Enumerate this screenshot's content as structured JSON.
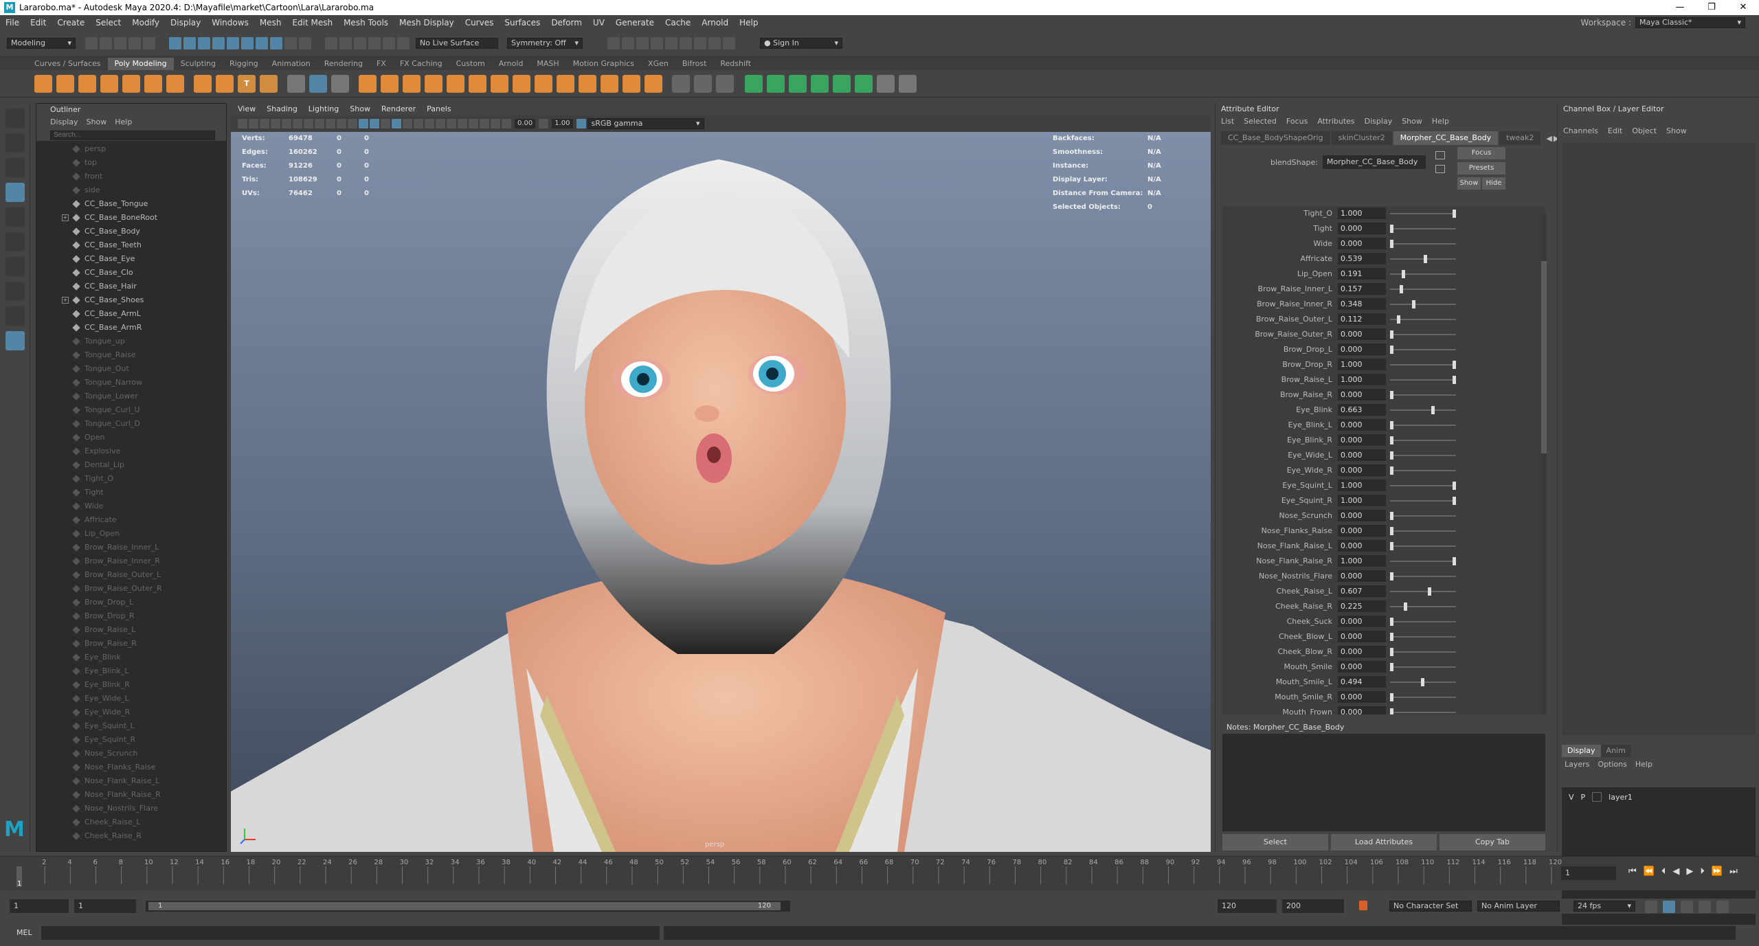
{
  "title": "Lararobo.ma* - Autodesk Maya 2020.4: D:\\Mayafile\\market\\Cartoon\\Lara\\Lararobo.ma",
  "menus": [
    "File",
    "Edit",
    "Create",
    "Select",
    "Modify",
    "Display",
    "Windows",
    "Mesh",
    "Edit Mesh",
    "Mesh Tools",
    "Mesh Display",
    "Curves",
    "Surfaces",
    "Deform",
    "UV",
    "Generate",
    "Cache",
    "Arnold",
    "Help"
  ],
  "workspace": {
    "label": "Workspace :",
    "value": "Maya Classic*"
  },
  "status": {
    "mode": "Modeling",
    "live": "No Live Surface",
    "symmetry": "Symmetry: Off",
    "signin": "Sign In"
  },
  "shelf_tabs": [
    "Curves / Surfaces",
    "Poly Modeling",
    "Sculpting",
    "Rigging",
    "Animation",
    "Rendering",
    "FX",
    "FX Caching",
    "Custom",
    "Arnold",
    "MASH",
    "Motion Graphics",
    "XGen",
    "Bifrost",
    "Redshift"
  ],
  "shelf_active": "Poly Modeling",
  "outliner": {
    "title": "Outliner",
    "menu": [
      "Display",
      "Show",
      "Help"
    ],
    "search": "Search...",
    "items": [
      {
        "name": "persp",
        "dim": true
      },
      {
        "name": "top",
        "dim": true
      },
      {
        "name": "front",
        "dim": true
      },
      {
        "name": "side",
        "dim": true
      },
      {
        "name": "CC_Base_Tongue",
        "dim": false
      },
      {
        "name": "CC_Base_BoneRoot",
        "dim": false,
        "exp": true
      },
      {
        "name": "CC_Base_Body",
        "dim": false
      },
      {
        "name": "CC_Base_Teeth",
        "dim": false
      },
      {
        "name": "CC_Base_Eye",
        "dim": false
      },
      {
        "name": "CC_Base_Clo",
        "dim": false
      },
      {
        "name": "CC_Base_Hair",
        "dim": false
      },
      {
        "name": "CC_Base_Shoes",
        "dim": false,
        "exp": true
      },
      {
        "name": "CC_Base_ArmL",
        "dim": false
      },
      {
        "name": "CC_Base_ArmR",
        "dim": false
      },
      {
        "name": "Tongue_up",
        "dim": true
      },
      {
        "name": "Tongue_Raise",
        "dim": true
      },
      {
        "name": "Tongue_Out",
        "dim": true
      },
      {
        "name": "Tongue_Narrow",
        "dim": true
      },
      {
        "name": "Tongue_Lower",
        "dim": true
      },
      {
        "name": "Tongue_Curl_U",
        "dim": true
      },
      {
        "name": "Tongue_Curl_D",
        "dim": true
      },
      {
        "name": "Open",
        "dim": true
      },
      {
        "name": "Explosive",
        "dim": true
      },
      {
        "name": "Dental_Lip",
        "dim": true
      },
      {
        "name": "Tight_O",
        "dim": true
      },
      {
        "name": "Tight",
        "dim": true
      },
      {
        "name": "Wide",
        "dim": true
      },
      {
        "name": "Affricate",
        "dim": true
      },
      {
        "name": "Lip_Open",
        "dim": true
      },
      {
        "name": "Brow_Raise_Inner_L",
        "dim": true
      },
      {
        "name": "Brow_Raise_Inner_R",
        "dim": true
      },
      {
        "name": "Brow_Raise_Outer_L",
        "dim": true
      },
      {
        "name": "Brow_Raise_Outer_R",
        "dim": true
      },
      {
        "name": "Brow_Drop_L",
        "dim": true
      },
      {
        "name": "Brow_Drop_R",
        "dim": true
      },
      {
        "name": "Brow_Raise_L",
        "dim": true
      },
      {
        "name": "Brow_Raise_R",
        "dim": true
      },
      {
        "name": "Eye_Blink",
        "dim": true
      },
      {
        "name": "Eye_Blink_L",
        "dim": true
      },
      {
        "name": "Eye_Blink_R",
        "dim": true
      },
      {
        "name": "Eye_Wide_L",
        "dim": true
      },
      {
        "name": "Eye_Wide_R",
        "dim": true
      },
      {
        "name": "Eye_Squint_L",
        "dim": true
      },
      {
        "name": "Eye_Squint_R",
        "dim": true
      },
      {
        "name": "Nose_Scrunch",
        "dim": true
      },
      {
        "name": "Nose_Flanks_Raise",
        "dim": true
      },
      {
        "name": "Nose_Flank_Raise_L",
        "dim": true
      },
      {
        "name": "Nose_Flank_Raise_R",
        "dim": true
      },
      {
        "name": "Nose_Nostrils_Flare",
        "dim": true
      },
      {
        "name": "Cheek_Raise_L",
        "dim": true
      },
      {
        "name": "Cheek_Raise_R",
        "dim": true
      }
    ]
  },
  "viewport": {
    "menu": [
      "View",
      "Shading",
      "Lighting",
      "Show",
      "Renderer",
      "Panels"
    ],
    "near": "0.00",
    "far": "1.00",
    "colorspace": "sRGB gamma",
    "camera": "persp",
    "hud_left": [
      [
        "Verts:",
        "69478",
        "0",
        "0"
      ],
      [
        "Edges:",
        "160262",
        "0",
        "0"
      ],
      [
        "Faces:",
        "91226",
        "0",
        "0"
      ],
      [
        "Tris:",
        "108629",
        "0",
        "0"
      ],
      [
        "UVs:",
        "76462",
        "0",
        "0"
      ]
    ],
    "hud_right": [
      [
        "Backfaces:",
        "N/A"
      ],
      [
        "Smoothness:",
        "N/A"
      ],
      [
        "Instance:",
        "N/A"
      ],
      [
        "Display Layer:",
        "N/A"
      ],
      [
        "Distance From Camera:",
        "N/A"
      ],
      [
        "Selected Objects:",
        "0"
      ]
    ]
  },
  "attr": {
    "title": "Attribute Editor",
    "menu": [
      "List",
      "Selected",
      "Focus",
      "Attributes",
      "Display",
      "Show",
      "Help"
    ],
    "tabs": [
      "CC_Base_BodyShapeOrig",
      "skinCluster2",
      "Morpher_CC_Base_Body",
      "tweak2"
    ],
    "active_tab": "Morpher_CC_Base_Body",
    "bs_label": "blendShape:",
    "bs_value": "Morpher_CC_Base_Body",
    "btn_focus": "Focus",
    "btn_presets": "Presets",
    "btn_show": "Show",
    "btn_hide": "Hide",
    "rows": [
      {
        "name": "Tight_O",
        "value": "1.000",
        "frac": 1.0
      },
      {
        "name": "Tight",
        "value": "0.000",
        "frac": 0
      },
      {
        "name": "Wide",
        "value": "0.000",
        "frac": 0
      },
      {
        "name": "Affricate",
        "value": "0.539",
        "frac": 0.539
      },
      {
        "name": "Lip_Open",
        "value": "0.191",
        "frac": 0.191
      },
      {
        "name": "Brow_Raise_Inner_L",
        "value": "0.157",
        "frac": 0.157
      },
      {
        "name": "Brow_Raise_Inner_R",
        "value": "0.348",
        "frac": 0.348
      },
      {
        "name": "Brow_Raise_Outer_L",
        "value": "0.112",
        "frac": 0.112
      },
      {
        "name": "Brow_Raise_Outer_R",
        "value": "0.000",
        "frac": 0
      },
      {
        "name": "Brow_Drop_L",
        "value": "0.000",
        "frac": 0
      },
      {
        "name": "Brow_Drop_R",
        "value": "1.000",
        "frac": 1
      },
      {
        "name": "Brow_Raise_L",
        "value": "1.000",
        "frac": 1
      },
      {
        "name": "Brow_Raise_R",
        "value": "0.000",
        "frac": 0
      },
      {
        "name": "Eye_Blink",
        "value": "0.663",
        "frac": 0.663
      },
      {
        "name": "Eye_Blink_L",
        "value": "0.000",
        "frac": 0
      },
      {
        "name": "Eye_Blink_R",
        "value": "0.000",
        "frac": 0
      },
      {
        "name": "Eye_Wide_L",
        "value": "0.000",
        "frac": 0
      },
      {
        "name": "Eye_Wide_R",
        "value": "0.000",
        "frac": 0
      },
      {
        "name": "Eye_Squint_L",
        "value": "1.000",
        "frac": 1
      },
      {
        "name": "Eye_Squint_R",
        "value": "1.000",
        "frac": 1
      },
      {
        "name": "Nose_Scrunch",
        "value": "0.000",
        "frac": 0
      },
      {
        "name": "Nose_Flanks_Raise",
        "value": "0.000",
        "frac": 0
      },
      {
        "name": "Nose_Flank_Raise_L",
        "value": "0.000",
        "frac": 0
      },
      {
        "name": "Nose_Flank_Raise_R",
        "value": "1.000",
        "frac": 1
      },
      {
        "name": "Nose_Nostrils_Flare",
        "value": "0.000",
        "frac": 0
      },
      {
        "name": "Cheek_Raise_L",
        "value": "0.607",
        "frac": 0.607
      },
      {
        "name": "Cheek_Raise_R",
        "value": "0.225",
        "frac": 0.225
      },
      {
        "name": "Cheek_Suck",
        "value": "0.000",
        "frac": 0
      },
      {
        "name": "Cheek_Blow_L",
        "value": "0.000",
        "frac": 0
      },
      {
        "name": "Cheek_Blow_R",
        "value": "0.000",
        "frac": 0
      },
      {
        "name": "Mouth_Smile",
        "value": "0.000",
        "frac": 0
      },
      {
        "name": "Mouth_Smile_L",
        "value": "0.494",
        "frac": 0.494
      },
      {
        "name": "Mouth_Smile_R",
        "value": "0.000",
        "frac": 0
      },
      {
        "name": "Mouth_Frown",
        "value": "0.000",
        "frac": 0
      }
    ],
    "notes_label": "Notes:",
    "notes_value": "Morpher_CC_Base_Body",
    "btn_select": "Select",
    "btn_load": "Load Attributes",
    "btn_copy": "Copy Tab"
  },
  "channelbox": {
    "title": "Channel Box / Layer Editor",
    "menu": [
      "Channels",
      "Edit",
      "Object",
      "Show"
    ],
    "layer_tabs": [
      "Display",
      "Anim"
    ],
    "layer_menu": [
      "Layers",
      "Options",
      "Help"
    ],
    "layer": {
      "v": "V",
      "p": "P",
      "name": "layer1"
    }
  },
  "timeline": {
    "ticks": [
      "2",
      "4",
      "6",
      "8",
      "10",
      "12",
      "14",
      "16",
      "18",
      "20",
      "22",
      "24",
      "26",
      "28",
      "30",
      "32",
      "34",
      "36",
      "38",
      "40",
      "42",
      "44",
      "46",
      "48",
      "50",
      "52",
      "54",
      "56",
      "58",
      "60",
      "62",
      "64",
      "66",
      "68",
      "70",
      "72",
      "74",
      "76",
      "78",
      "80",
      "82",
      "84",
      "86",
      "88",
      "90",
      "92",
      "94",
      "96",
      "98",
      "100",
      "102",
      "104",
      "106",
      "108",
      "110",
      "112",
      "114",
      "116",
      "118",
      "120"
    ],
    "current": "1",
    "current_field": "1"
  },
  "range": {
    "start": "1",
    "start2": "1",
    "inner_start": "1",
    "inner_end": "120",
    "end": "120",
    "end2": "200",
    "charset": "No Character Set",
    "animlayer": "No Anim Layer",
    "fps": "24 fps"
  },
  "cmd": {
    "label": "MEL"
  }
}
